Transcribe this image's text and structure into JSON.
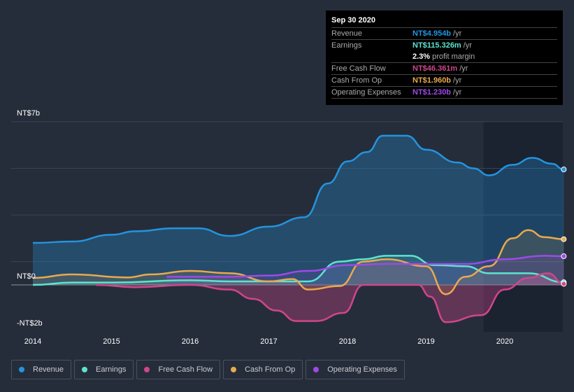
{
  "tooltip": {
    "date": "Sep 30 2020",
    "rows": [
      {
        "label": "Revenue",
        "value": "NT$4.954b",
        "unit": "/yr",
        "color": "#2394df"
      },
      {
        "label": "Earnings",
        "value": "NT$115.326m",
        "unit": "/yr",
        "color": "#5ee3cf"
      },
      {
        "label": "",
        "value": "2.3%",
        "unit": "profit margin",
        "color": "#ffffff"
      },
      {
        "label": "Free Cash Flow",
        "value": "NT$46.361m",
        "unit": "/yr",
        "color": "#d0468b"
      },
      {
        "label": "Cash From Op",
        "value": "NT$1.960b",
        "unit": "/yr",
        "color": "#e9a94f"
      },
      {
        "label": "Operating Expenses",
        "value": "NT$1.230b",
        "unit": "/yr",
        "color": "#9e4ae6"
      }
    ]
  },
  "chart_data": {
    "type": "area",
    "ylim": [
      -2,
      7
    ],
    "xlim": [
      2013.7,
      2020.75
    ],
    "y_tick_labels": [
      "NT$7b",
      "NT$0",
      "-NT$2b"
    ],
    "x_ticks": [
      2014,
      2015,
      2016,
      2017,
      2018,
      2019,
      2020
    ],
    "grid": true,
    "legend_position": "bottom",
    "series": [
      {
        "name": "Revenue",
        "color": "#2394df",
        "points": [
          [
            2014,
            1.8
          ],
          [
            2014.5,
            1.86
          ],
          [
            2015,
            2.15
          ],
          [
            2015.3,
            2.3
          ],
          [
            2015.8,
            2.43
          ],
          [
            2016.1,
            2.43
          ],
          [
            2016.5,
            2.1
          ],
          [
            2017,
            2.5
          ],
          [
            2017.45,
            2.9
          ],
          [
            2017.75,
            4.35
          ],
          [
            2018,
            5.3
          ],
          [
            2018.25,
            5.7
          ],
          [
            2018.45,
            6.4
          ],
          [
            2018.75,
            6.4
          ],
          [
            2019,
            5.8
          ],
          [
            2019.4,
            5.25
          ],
          [
            2019.6,
            5.0
          ],
          [
            2019.8,
            4.7
          ],
          [
            2020.1,
            5.15
          ],
          [
            2020.35,
            5.45
          ],
          [
            2020.6,
            5.2
          ],
          [
            2020.75,
            4.954
          ]
        ]
      },
      {
        "name": "Earnings",
        "color": "#5ee3cf",
        "points": [
          [
            2014,
            0.0
          ],
          [
            2014.5,
            0.1
          ],
          [
            2015,
            0.1
          ],
          [
            2016,
            0.2
          ],
          [
            2016.5,
            0.15
          ],
          [
            2017,
            0.15
          ],
          [
            2017.5,
            0.15
          ],
          [
            2017.9,
            1.0
          ],
          [
            2018.2,
            1.1
          ],
          [
            2018.5,
            1.25
          ],
          [
            2018.8,
            1.25
          ],
          [
            2019.1,
            0.85
          ],
          [
            2019.5,
            0.8
          ],
          [
            2019.8,
            0.5
          ],
          [
            2020.3,
            0.5
          ],
          [
            2020.75,
            0.115
          ]
        ]
      },
      {
        "name": "Free Cash Flow",
        "color": "#d0468b",
        "points": [
          [
            2014.8,
            0
          ],
          [
            2015.3,
            -0.1
          ],
          [
            2016,
            0
          ],
          [
            2016.5,
            -0.2
          ],
          [
            2016.8,
            -0.6
          ],
          [
            2017.1,
            -1.1
          ],
          [
            2017.35,
            -1.55
          ],
          [
            2017.6,
            -1.55
          ],
          [
            2017.95,
            -1.2
          ],
          [
            2018.2,
            0
          ],
          [
            2018.9,
            0
          ],
          [
            2019.05,
            -0.5
          ],
          [
            2019.25,
            -1.6
          ],
          [
            2019.7,
            -1.3
          ],
          [
            2020,
            -0.2
          ],
          [
            2020.3,
            0.3
          ],
          [
            2020.55,
            0.5
          ],
          [
            2020.75,
            0.046
          ]
        ]
      },
      {
        "name": "Cash From Op",
        "color": "#e9a94f",
        "points": [
          [
            2014,
            0.3
          ],
          [
            2014.5,
            0.45
          ],
          [
            2015.2,
            0.32
          ],
          [
            2015.5,
            0.45
          ],
          [
            2016,
            0.6
          ],
          [
            2016.5,
            0.5
          ],
          [
            2017,
            0.15
          ],
          [
            2017.3,
            0.25
          ],
          [
            2017.5,
            -0.2
          ],
          [
            2017.9,
            -0.05
          ],
          [
            2018.2,
            1.0
          ],
          [
            2018.5,
            1.1
          ],
          [
            2019,
            0.8
          ],
          [
            2019.25,
            -0.4
          ],
          [
            2019.5,
            0.35
          ],
          [
            2019.8,
            0.8
          ],
          [
            2020.1,
            2.0
          ],
          [
            2020.3,
            2.35
          ],
          [
            2020.5,
            2.05
          ],
          [
            2020.75,
            1.96
          ]
        ]
      },
      {
        "name": "Operating Expenses",
        "color": "#9e4ae6",
        "points": [
          [
            2015.7,
            0.35
          ],
          [
            2016.5,
            0.35
          ],
          [
            2017,
            0.4
          ],
          [
            2017.5,
            0.6
          ],
          [
            2018,
            0.85
          ],
          [
            2018.5,
            0.9
          ],
          [
            2019,
            0.9
          ],
          [
            2019.5,
            0.9
          ],
          [
            2020,
            1.1
          ],
          [
            2020.5,
            1.25
          ],
          [
            2020.75,
            1.23
          ]
        ]
      }
    ]
  },
  "legend": [
    "Revenue",
    "Earnings",
    "Free Cash Flow",
    "Cash From Op",
    "Operating Expenses"
  ]
}
